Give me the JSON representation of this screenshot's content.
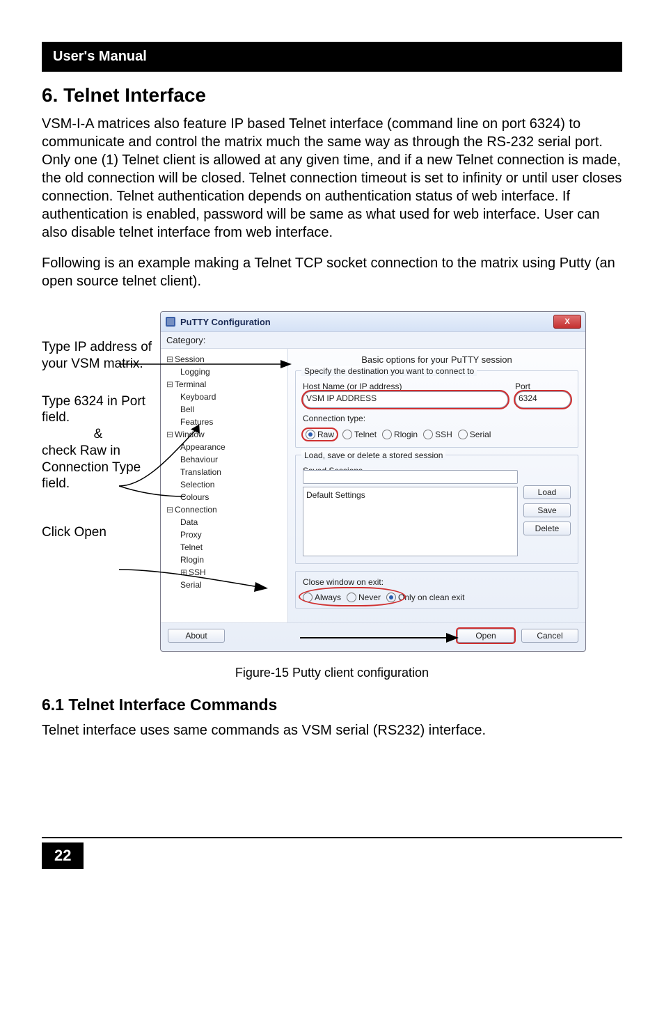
{
  "header": {
    "manual": "User's Manual"
  },
  "h1": "6. Telnet Interface",
  "p1": "VSM-I-A matrices also feature IP based Telnet interface (command line on port 6324) to communicate and control the matrix much the same way as through the RS-232 serial port. Only one (1) Telnet client is allowed at any given time, and if a new Telnet connection is made, the old connection will be closed. Telnet connection timeout is set to infinity or until user closes connection. Telnet authentication depends on authentication status of web interface. If authentication is enabled, password will be same as what used for web interface. User can also disable telnet interface from web interface.",
  "p2": "Following is an example making a Telnet TCP socket connection to the matrix using Putty (an open source telnet client).",
  "instructions": {
    "b1": "Type IP address of your VSM matrix.",
    "b2a": "Type 6324 in Port field.",
    "b2b": "&",
    "b2c": "check Raw in Connection Type field.",
    "b3": "Click Open"
  },
  "putty": {
    "title": "PuTTY Configuration",
    "close": "X",
    "categoryLabel": "Category:",
    "tree": {
      "session": "Session",
      "logging": "Logging",
      "terminal": "Terminal",
      "keyboard": "Keyboard",
      "bell": "Bell",
      "features": "Features",
      "window": "Window",
      "appearance": "Appearance",
      "behaviour": "Behaviour",
      "translation": "Translation",
      "selection": "Selection",
      "colours": "Colours",
      "connection": "Connection",
      "data": "Data",
      "proxy": "Proxy",
      "telnet": "Telnet",
      "rlogin": "Rlogin",
      "ssh": "SSH",
      "serial": "Serial"
    },
    "panel": {
      "title": "Basic options for your PuTTY session",
      "group1": "Specify the destination you want to connect to",
      "hostLabel": "Host Name (or IP address)",
      "portLabel": "Port",
      "hostValue": "VSM IP ADDRESS",
      "portValue": "6324",
      "connType": "Connection type:",
      "raw": "Raw",
      "telnet": "Telnet",
      "rlogin": "Rlogin",
      "ssh": "SSH",
      "serial": "Serial",
      "group2": "Load, save or delete a stored session",
      "saved": "Saved Sessions",
      "defaultSettings": "Default Settings",
      "load": "Load",
      "save": "Save",
      "delete": "Delete",
      "closeExit": "Close window on exit:",
      "always": "Always",
      "never": "Never",
      "onlyClean": "Only on clean exit",
      "about": "About",
      "open": "Open",
      "cancel": "Cancel"
    }
  },
  "caption": "Figure-15 Putty client configuration",
  "h2": "6.1 Telnet Interface Commands",
  "p3": "Telnet interface uses same commands as VSM serial (RS232) interface.",
  "pageNumber": "22"
}
